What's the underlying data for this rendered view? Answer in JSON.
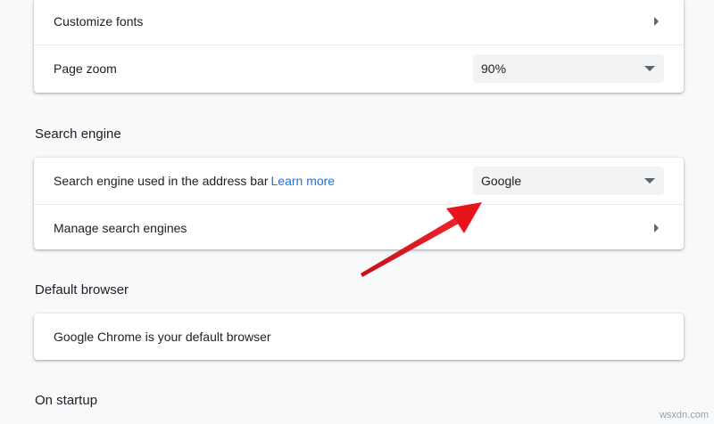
{
  "appearance": {
    "customize_fonts_label": "Customize fonts",
    "page_zoom_label": "Page zoom",
    "page_zoom_value": "90%"
  },
  "search_engine": {
    "section_title": "Search engine",
    "address_bar_label": "Search engine used in the address bar",
    "learn_more_link": "Learn more",
    "selected_engine": "Google",
    "manage_label": "Manage search engines"
  },
  "default_browser": {
    "section_title": "Default browser",
    "status_text": "Google Chrome is your default browser"
  },
  "on_startup": {
    "section_title": "On startup"
  },
  "annotation": {
    "arrow_color": "#e8141b"
  },
  "watermark": "wsxdn.com",
  "colors": {
    "page_background": "#f8f9fa",
    "card_background": "#ffffff",
    "link": "#1a73e8",
    "select_background": "#f1f3f4"
  }
}
